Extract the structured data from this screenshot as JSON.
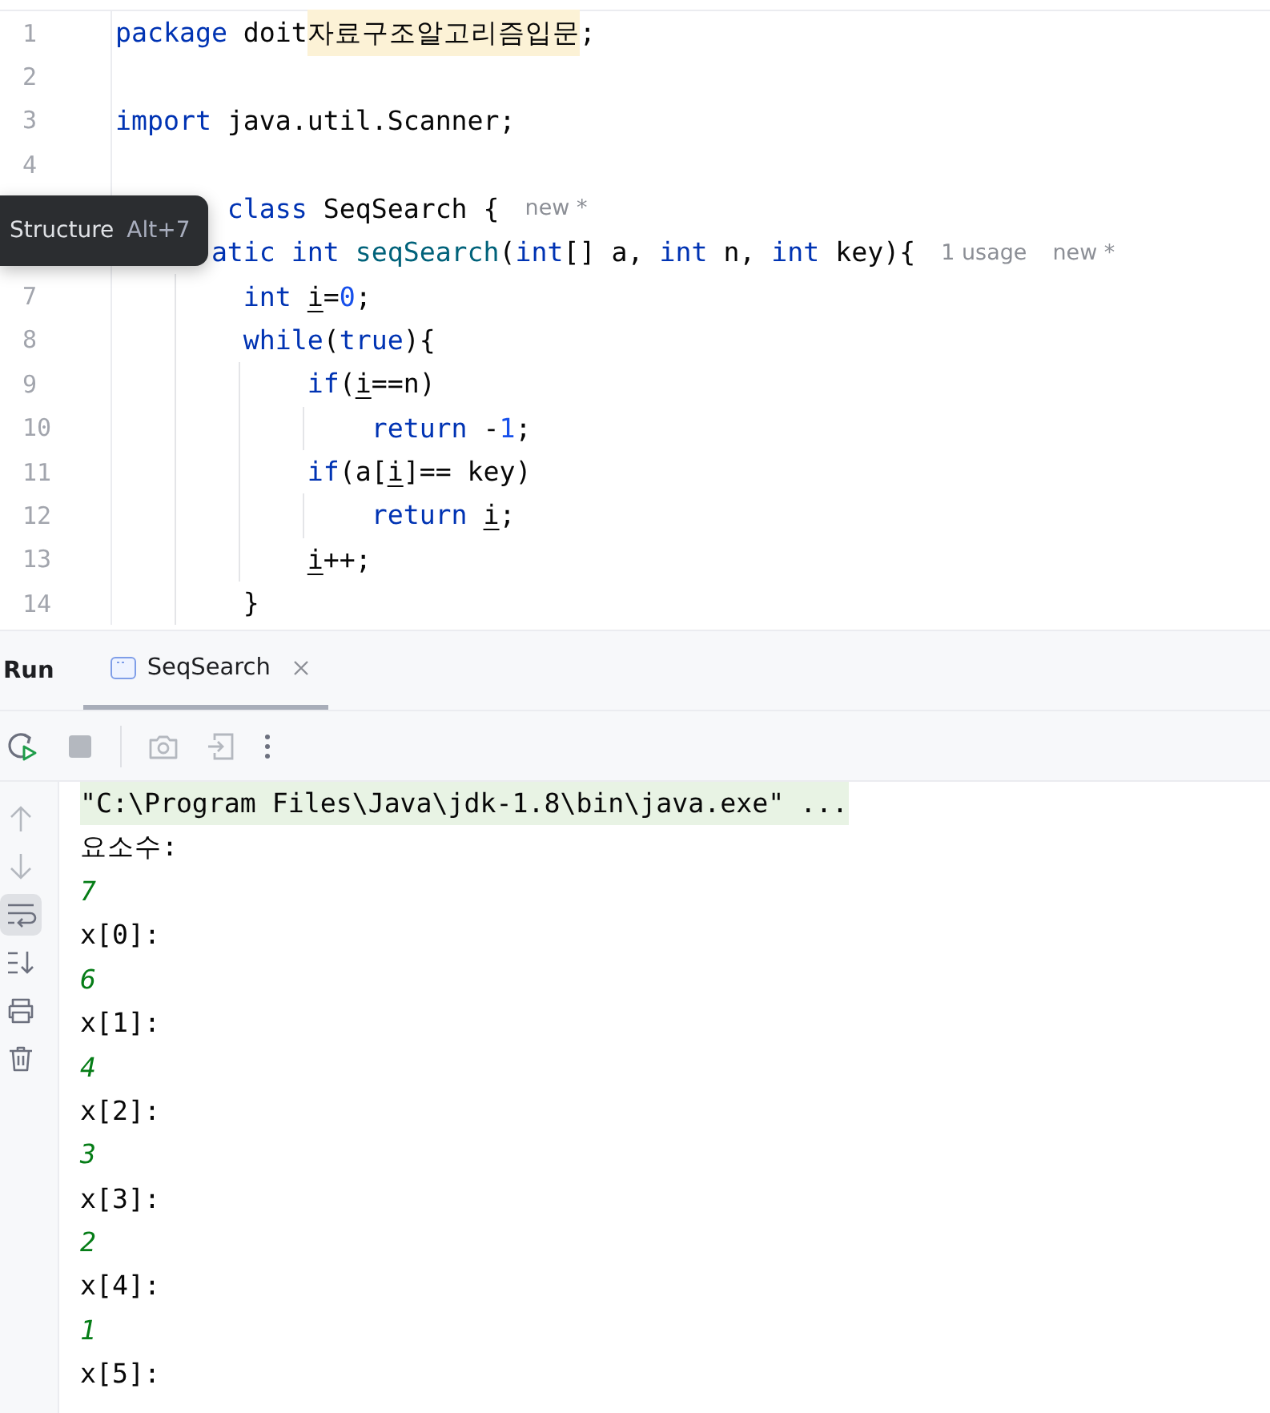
{
  "editor": {
    "lines": [
      {
        "number": "1",
        "covered": false,
        "tokens": [
          {
            "text": "package doit",
            "kind": "keyword-first"
          },
          {
            "text": "자료구조알고리즘입문",
            "kind": "highlight"
          },
          {
            "text": ";",
            "kind": "plain"
          }
        ]
      },
      {
        "number": "2"
      },
      {
        "number": "3",
        "covered": false,
        "tokens": [
          {
            "text": "import java.util.Scanner;",
            "kind": "keyword-first"
          }
        ]
      },
      {
        "number": "4"
      },
      {
        "covered": true,
        "tokens": [
          {
            "text": " class",
            "kind": "keyword"
          },
          {
            "text": " SeqSearch {",
            "kind": "plain"
          }
        ],
        "hints": [
          "new *"
        ],
        "children": [
          {
            "covered": true,
            "tokens": [
              {
                "text": "atic int",
                "kind": "keyword"
              },
              {
                "text": " seqSearch",
                "kind": "method"
              },
              {
                "text": "(",
                "kind": "plain"
              },
              {
                "text": "int",
                "kind": "keyword"
              },
              {
                "text": "[] a, ",
                "kind": "plain"
              },
              {
                "text": "int",
                "kind": "keyword"
              },
              {
                "text": " n, ",
                "kind": "plain"
              },
              {
                "text": "int",
                "kind": "keyword"
              },
              {
                "text": " key){",
                "kind": "plain"
              }
            ],
            "hints": [
              "1 usage",
              "new *"
            ],
            "children": [
              {
                "number": "7",
                "covered": false,
                "tokens": [
                  {
                    "text": "int ",
                    "kind": "keyword"
                  },
                  {
                    "text": "i",
                    "kind": "reassigned"
                  },
                  {
                    "text": "=",
                    "kind": "plain"
                  },
                  {
                    "text": "0",
                    "kind": "number"
                  },
                  {
                    "text": ";",
                    "kind": "plain"
                  }
                ]
              },
              {
                "number": "8",
                "covered": false,
                "tokens": [
                  {
                    "text": "while",
                    "kind": "keyword"
                  },
                  {
                    "text": "(",
                    "kind": "plain"
                  },
                  {
                    "text": "true",
                    "kind": "keyword"
                  },
                  {
                    "text": "){",
                    "kind": "plain"
                  }
                ],
                "children": [
                  {
                    "number": "9",
                    "covered": false,
                    "tokens": [
                      {
                        "text": "if",
                        "kind": "keyword"
                      },
                      {
                        "text": "(",
                        "kind": "plain"
                      },
                      {
                        "text": "i",
                        "kind": "reassigned"
                      },
                      {
                        "text": "==n)",
                        "kind": "plain"
                      }
                    ],
                    "children": [
                      {
                        "number": "10",
                        "covered": false,
                        "tokens": [
                          {
                            "text": "return",
                            "kind": "keyword"
                          },
                          {
                            "text": " -",
                            "kind": "plain"
                          },
                          {
                            "text": "1",
                            "kind": "number"
                          },
                          {
                            "text": ";",
                            "kind": "plain"
                          }
                        ]
                      }
                    ]
                  },
                  {
                    "number": "11",
                    "covered": false,
                    "tokens": [
                      {
                        "text": "if",
                        "kind": "keyword"
                      },
                      {
                        "text": "(a[",
                        "kind": "plain"
                      },
                      {
                        "text": "i",
                        "kind": "reassigned"
                      },
                      {
                        "text": "]== key)",
                        "kind": "plain"
                      }
                    ],
                    "children": [
                      {
                        "number": "12",
                        "covered": false,
                        "tokens": [
                          {
                            "text": "return ",
                            "kind": "keyword"
                          },
                          {
                            "text": "i",
                            "kind": "reassigned"
                          },
                          {
                            "text": ";",
                            "kind": "plain"
                          }
                        ]
                      }
                    ]
                  },
                  {
                    "number": "13",
                    "covered": false,
                    "tokens": [
                      {
                        "text": "i",
                        "kind": "reassigned"
                      },
                      {
                        "text": "++;",
                        "kind": "plain"
                      }
                    ]
                  }
                ]
              },
              {
                "number": "14",
                "covered": false,
                "tokens": [
                  {
                    "text": "}",
                    "kind": "plain"
                  }
                ]
              }
            ]
          }
        ]
      }
    ]
  },
  "tooltip": {
    "title": "Structure",
    "shortcut": "Alt+7"
  },
  "run_panel": {
    "title": "Run",
    "tabs": [
      {
        "label": "SeqSearch",
        "selected": true
      }
    ],
    "toolbar": [
      {
        "kind": "rerun",
        "disabled": false
      },
      {
        "kind": "stop",
        "disabled": true
      },
      {
        "kind": "separator"
      },
      {
        "kind": "camera",
        "disabled": true
      },
      {
        "kind": "exit",
        "disabled": true
      },
      {
        "kind": "more",
        "disabled": false
      }
    ],
    "side_tools": [
      {
        "kind": "up",
        "on": false,
        "disabled": true
      },
      {
        "kind": "down",
        "on": false,
        "disabled": true
      },
      {
        "kind": "wrap",
        "on": true,
        "disabled": false
      },
      {
        "kind": "scroll-end",
        "on": false,
        "disabled": false
      },
      {
        "kind": "print",
        "on": false,
        "disabled": false
      },
      {
        "kind": "trash",
        "on": false,
        "disabled": false
      }
    ],
    "console": [
      {
        "kind": "command",
        "text": "\"C:\\Program Files\\Java\\jdk-1.8\\bin\\java.exe\" ..."
      },
      {
        "kind": "output",
        "text": "요소수:"
      },
      {
        "kind": "input",
        "text": "7"
      },
      {
        "kind": "output",
        "text": "x[0]:"
      },
      {
        "kind": "input",
        "text": "6"
      },
      {
        "kind": "output",
        "text": "x[1]:"
      },
      {
        "kind": "input",
        "text": "4"
      },
      {
        "kind": "output",
        "text": "x[2]:"
      },
      {
        "kind": "input",
        "text": "3"
      },
      {
        "kind": "output",
        "text": "x[3]:"
      },
      {
        "kind": "input",
        "text": "2"
      },
      {
        "kind": "output",
        "text": "x[4]:"
      },
      {
        "kind": "input",
        "text": "1"
      },
      {
        "kind": "output",
        "text": "x[5]:"
      }
    ]
  }
}
